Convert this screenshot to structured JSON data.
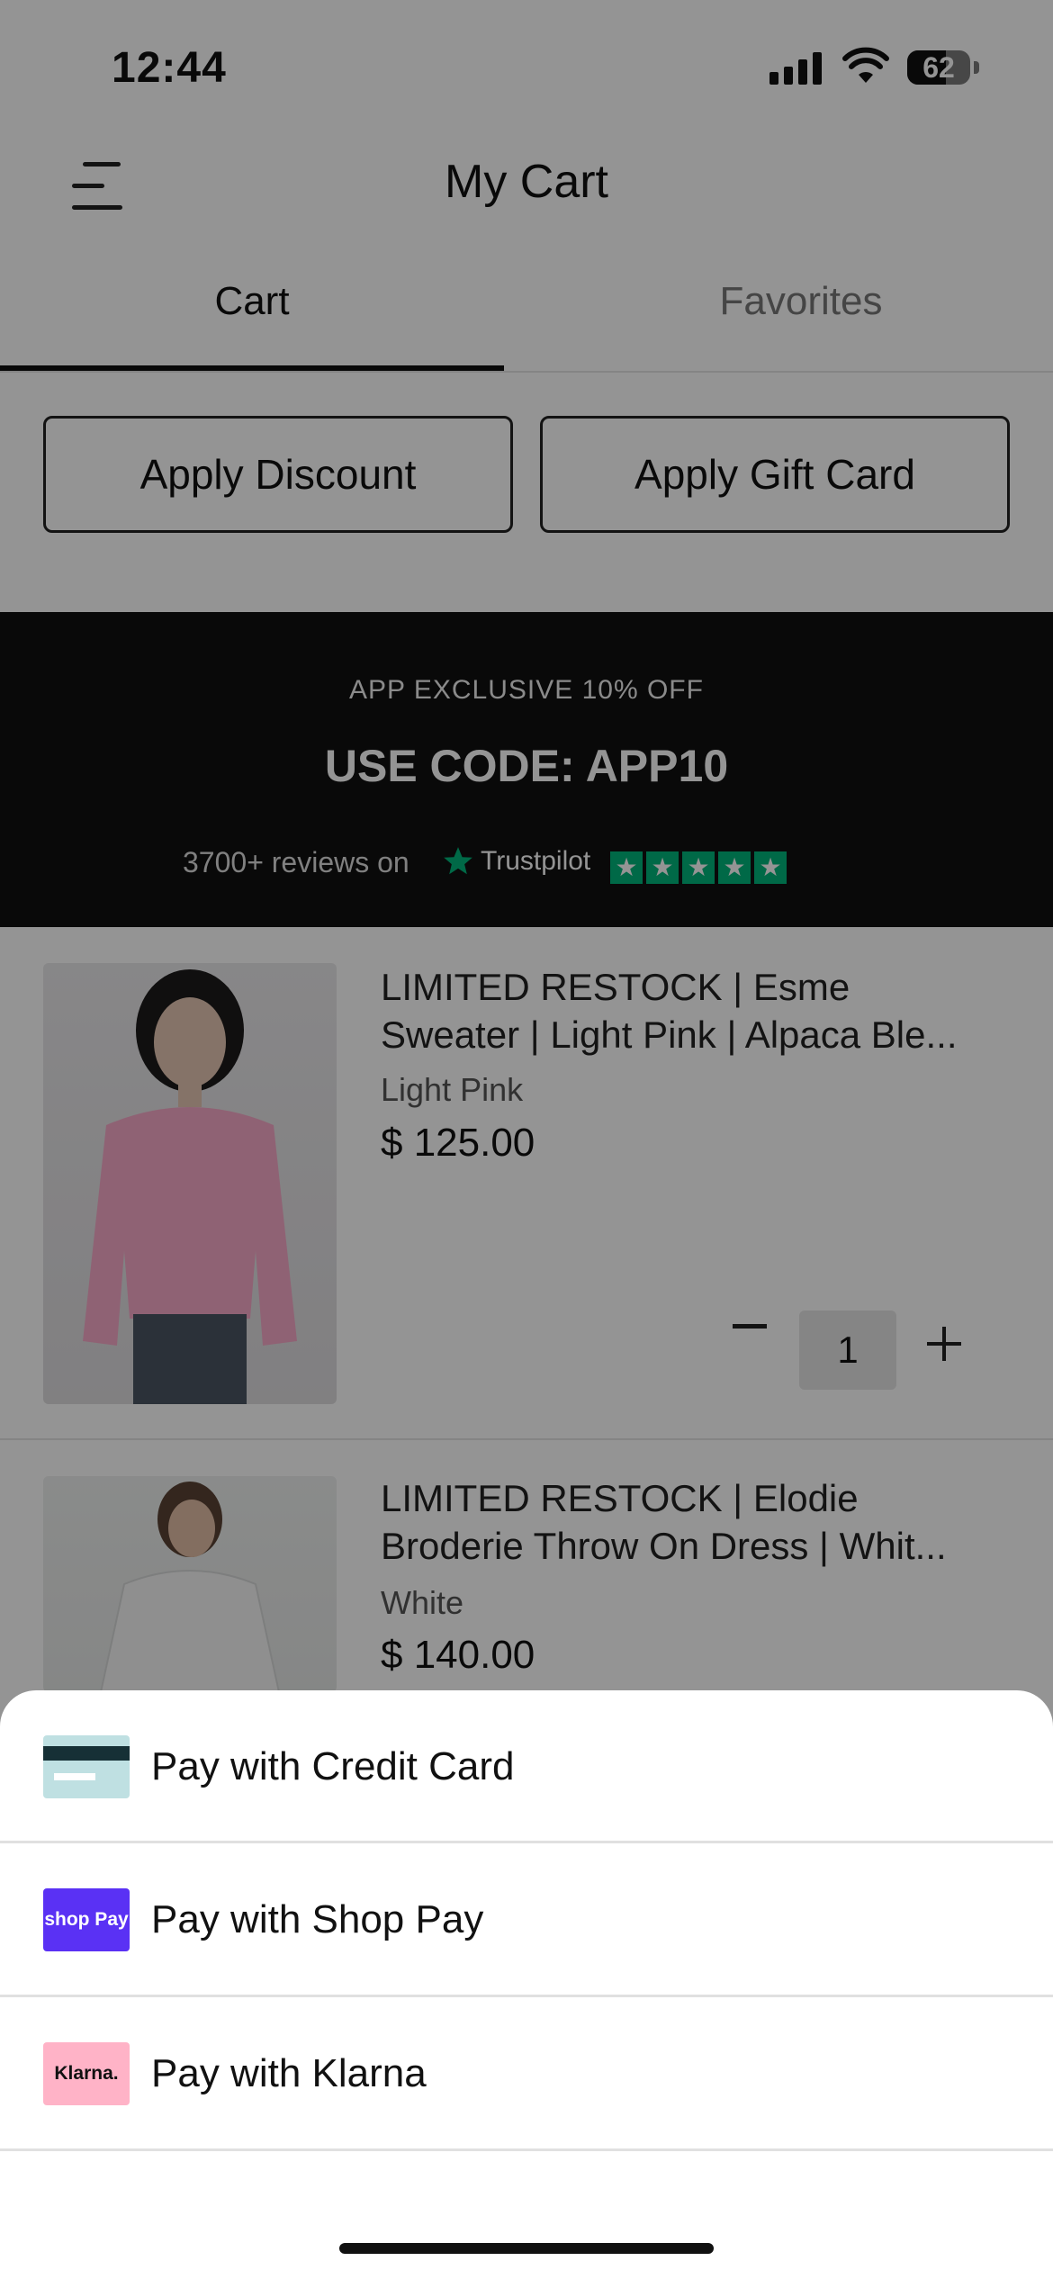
{
  "status_bar": {
    "time": "12:44",
    "battery": "62"
  },
  "header": {
    "title": "My Cart",
    "menu_icon": "hamburger-menu-icon"
  },
  "tabs": [
    {
      "label": "Cart",
      "active": true
    },
    {
      "label": "Favorites",
      "active": false
    }
  ],
  "actions": {
    "discount_label": "Apply Discount",
    "gift_label": "Apply Gift Card"
  },
  "promo": {
    "headline": "APP EXCLUSIVE 10% OFF",
    "code_text": "USE CODE: APP10",
    "reviews_text": "3700+ reviews on",
    "trustpilot_label": "Trustpilot",
    "trustpilot_color": "#00b67a"
  },
  "cart_items": [
    {
      "title_line1": "LIMITED RESTOCK | Esme",
      "title_line2": "Sweater | Light Pink | Alpaca Ble...",
      "variant": "Light Pink",
      "price": "$ 125.00",
      "quantity": "1"
    },
    {
      "title_line1": "LIMITED RESTOCK | Elodie",
      "title_line2": "Broderie Throw On Dress | Whit...",
      "variant": "White",
      "price": "$ 140.00"
    }
  ],
  "payment_sheet": {
    "options": [
      {
        "label": "Pay with Credit Card",
        "icon": "credit-card-icon"
      },
      {
        "label": "Pay with Shop Pay",
        "icon": "shop-pay-icon",
        "icon_text": "shop Pay",
        "icon_color": "#5a31f4"
      },
      {
        "label": "Pay with Klarna",
        "icon": "klarna-icon",
        "icon_text": "Klarna.",
        "icon_color": "#ffb3c7"
      }
    ]
  }
}
